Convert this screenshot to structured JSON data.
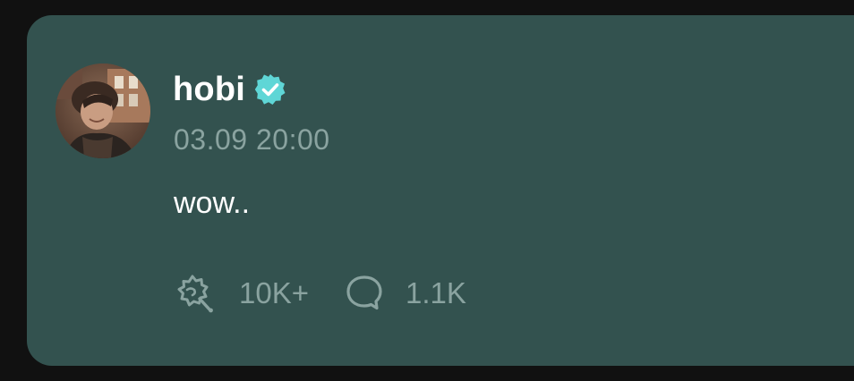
{
  "post": {
    "author": {
      "username": "hobi",
      "verified": true,
      "verified_icon": "verified-badge-icon",
      "avatar": "profile photo"
    },
    "timestamp": "03.09 20:00",
    "text": "wow..",
    "reactions": {
      "like_icon": "like-reaction-icon",
      "like_count": "10K+",
      "comment_icon": "comment-bubble-icon",
      "comment_count": "1.1K"
    }
  },
  "colors": {
    "page_background": "#111111",
    "card_background": "#33524f",
    "primary_text": "#ffffff",
    "secondary_text": "#8aa3a0",
    "verified_badge": "#5fd6d6"
  }
}
